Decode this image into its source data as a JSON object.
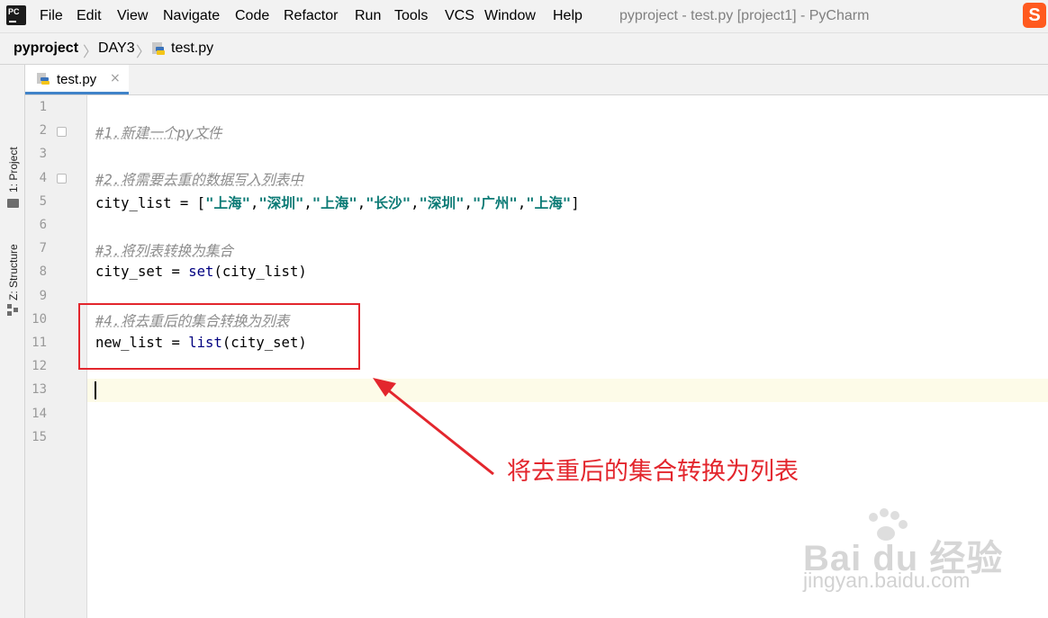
{
  "app": {
    "icon_label": "PC",
    "window_title": "pyproject - test.py [project1] - PyCharm",
    "menu": [
      "File",
      "Edit",
      "View",
      "Navigate",
      "Code",
      "Refactor",
      "Run",
      "Tools",
      "VCS",
      "Window",
      "Help"
    ],
    "ime_icon_label": "S"
  },
  "breadcrumb": [
    "pyproject",
    "DAY3",
    "test.py"
  ],
  "tool_windows": [
    "1: Project",
    "Z: Structure"
  ],
  "tabs": [
    {
      "label": "test.py",
      "close": "×"
    }
  ],
  "editor": {
    "line_numbers": [
      "1",
      "2",
      "3",
      "4",
      "5",
      "6",
      "7",
      "8",
      "9",
      "10",
      "11",
      "12",
      "13",
      "14",
      "15"
    ],
    "current_line": 13,
    "lines": {
      "l2": "#1.新建一个py文件",
      "l4": "#2.将需要去重的数据写入列表中",
      "l5": {
        "prefix": "city_list = [",
        "strings": [
          "\"上海\"",
          "\"深圳\"",
          "\"上海\"",
          "\"长沙\"",
          "\"深圳\"",
          "\"广州\"",
          "\"上海\""
        ],
        "sep": ",",
        "suffix": "]"
      },
      "l7": "#3.将列表转换为集合",
      "l8": {
        "a": "city_set = ",
        "fn": "set",
        "b": "(city_list)"
      },
      "l10": "#4.将去重后的集合转换为列表",
      "l11": {
        "a": "new_list = ",
        "fn": "list",
        "b": "(city_set)"
      }
    }
  },
  "annotation": {
    "text": "将去重后的集合转换为列表",
    "color": "#e3262d"
  },
  "watermark": {
    "line1": "Bai du 经验",
    "line2": "jingyan.baidu.com"
  }
}
